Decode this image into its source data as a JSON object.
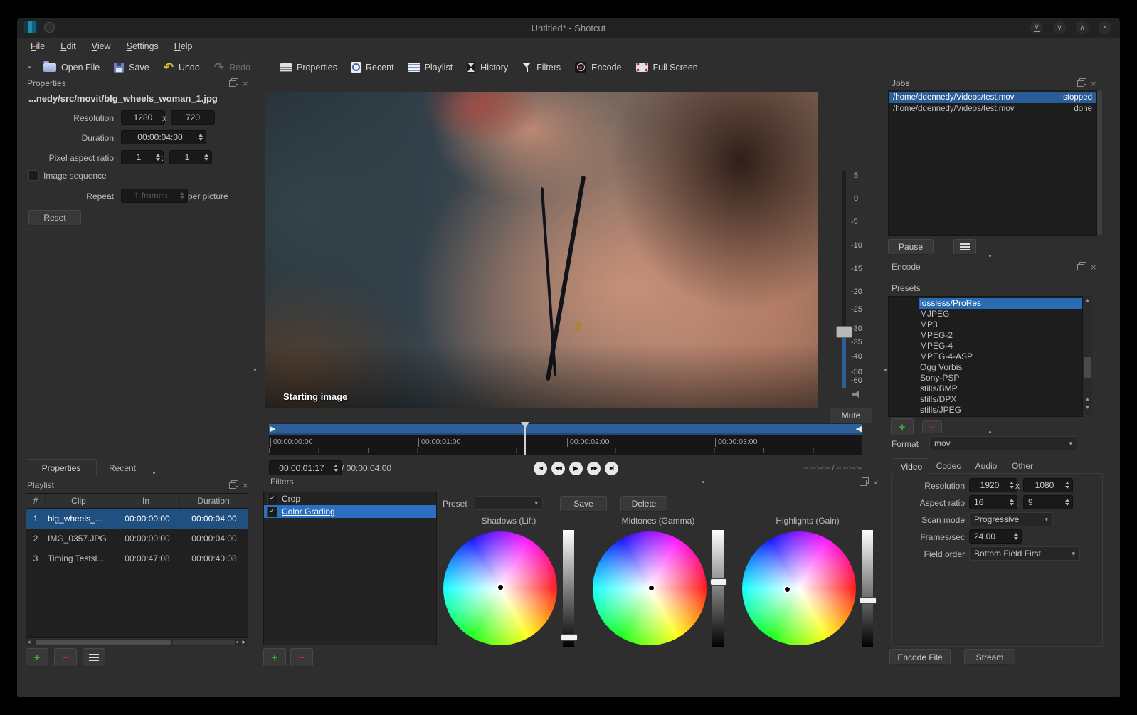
{
  "window": {
    "title": "Untitled* - Shotcut"
  },
  "icons": {
    "check": "✓",
    "combo_arrow": "▾",
    "close": "×",
    "undo_glyph": "↶",
    "redo_glyph": "↷",
    "scroll_up": "▴",
    "scroll_down": "▾",
    "scroll_left": "◂",
    "scroll_right": "▸",
    "marker_in": "▶",
    "marker_out": "◀",
    "shade": "∨",
    "minimize": "∨",
    "maximize": "∧",
    "transport": [
      "|◀",
      "◀◀",
      "▶",
      "▶▶",
      "▶|"
    ]
  },
  "menu": {
    "items": [
      "File",
      "Edit",
      "View",
      "Settings",
      "Help"
    ]
  },
  "toolbar": {
    "open_file": "Open File",
    "save": "Save",
    "undo": "Undo",
    "redo": "Redo",
    "properties": "Properties",
    "recent": "Recent",
    "playlist": "Playlist",
    "history": "History",
    "filters": "Filters",
    "encode": "Encode",
    "full_screen": "Full Screen"
  },
  "properties": {
    "title": "Properties",
    "filename": "...nedy/src/movit/blg_wheels_woman_1.jpg",
    "resolution_label": "Resolution",
    "resolution_w": "1280",
    "resolution_x": "x",
    "resolution_h": "720",
    "duration_label": "Duration",
    "duration_value": "00:00:04:00",
    "par_label": "Pixel aspect ratio",
    "par_num": "1",
    "par_colon": ":",
    "par_den": "1",
    "image_sequence_label": "Image sequence",
    "repeat_label": "Repeat",
    "repeat_value": "1 frames",
    "repeat_suffix": "per picture",
    "reset_label": "Reset",
    "tab_properties": "Properties",
    "tab_recent": "Recent"
  },
  "playlist": {
    "title": "Playlist",
    "columns": [
      "#",
      "Clip",
      "In",
      "Duration"
    ],
    "rows": [
      {
        "num": "1",
        "clip": "blg_wheels_...",
        "in": "00:00:00:00",
        "duration": "00:00:04:00"
      },
      {
        "num": "2",
        "clip": "IMG_0357.JPG",
        "in": "00:00:00:00",
        "duration": "00:00:04:00"
      },
      {
        "num": "3",
        "clip": "Timing Testsl...",
        "in": "00:00:47:08",
        "duration": "00:00:40:08"
      }
    ]
  },
  "preview": {
    "overlay": "Starting image",
    "mute_label": "Mute",
    "volume_scale": [
      "5",
      "0",
      "-5",
      "-10",
      "-15",
      "-20",
      "-25",
      "-30",
      "-35",
      "-40",
      "-50",
      "-60"
    ]
  },
  "timeline": {
    "ticks": [
      "00:00:00:00",
      "00:00:01:00",
      "00:00:02:00",
      "00:00:03:00"
    ],
    "position": "00:00:01:17",
    "total": "/ 00:00:04:00",
    "selection": "--:--:--:-- / --:--:--:--"
  },
  "filters": {
    "title": "Filters",
    "items": [
      {
        "label": "Crop"
      },
      {
        "label": "Color Grading"
      }
    ],
    "preset_label": "Preset",
    "save_label": "Save",
    "delete_label": "Delete",
    "wheels": [
      {
        "label": "Shadows (Lift)"
      },
      {
        "label": "Midtones (Gamma)"
      },
      {
        "label": "Highlights (Gain)"
      }
    ]
  },
  "jobs": {
    "title": "Jobs",
    "rows": [
      {
        "path": "/home/ddennedy/Videos/test.mov",
        "status": "stopped"
      },
      {
        "path": "/home/ddennedy/Videos/test.mov",
        "status": "done"
      }
    ],
    "pause_label": "Pause"
  },
  "encode": {
    "title": "Encode",
    "presets_label": "Presets",
    "presets": [
      "lossless/ProRes",
      "MJPEG",
      "MP3",
      "MPEG-2",
      "MPEG-4",
      "MPEG-4-ASP",
      "Ogg Vorbis",
      "Sony-PSP",
      "stills/BMP",
      "stills/DPX",
      "stills/JPEG"
    ],
    "format_label": "Format",
    "format_value": "mov",
    "tabs": [
      "Video",
      "Codec",
      "Audio",
      "Other"
    ],
    "video_tab": {
      "resolution_label": "Resolution",
      "resolution_w": "1920",
      "resolution_x": "x",
      "resolution_h": "1080",
      "aspect_label": "Aspect ratio",
      "aspect_num": "16",
      "aspect_colon": ":",
      "aspect_den": "9",
      "scan_label": "Scan mode",
      "scan_value": "Progressive",
      "fps_label": "Frames/sec",
      "fps_value": "24.00",
      "field_label": "Field order",
      "field_value": "Bottom Field First"
    },
    "encode_file_label": "Encode File",
    "stream_label": "Stream"
  },
  "colors": {
    "selection_bright": "#2a6cb4",
    "selection_list": "#1f5080",
    "timeline_blue": "#2e5f99"
  }
}
